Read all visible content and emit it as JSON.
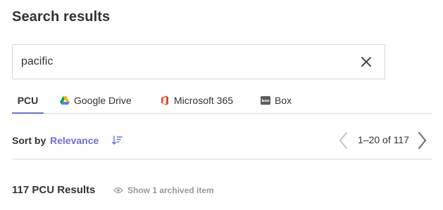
{
  "header": {
    "title": "Search results"
  },
  "search": {
    "value": "pacific",
    "clear_icon": "close-icon"
  },
  "tabs": [
    {
      "label": "PCU",
      "active": true
    },
    {
      "label": "Google Drive",
      "icon": "google-drive-icon"
    },
    {
      "label": "Microsoft 365",
      "icon": "microsoft-365-icon"
    },
    {
      "label": "Box",
      "icon": "box-icon"
    }
  ],
  "sort": {
    "label": "Sort by",
    "value": "Relevance",
    "icon": "sort-descending-icon"
  },
  "pagination": {
    "range": "1–20 of 117",
    "prev_icon": "chevron-left-icon",
    "next_icon": "chevron-right-icon"
  },
  "results": {
    "count_label": "117 PCU Results",
    "archived_label": "Show 1 archived item",
    "archived_icon": "eye-icon"
  },
  "colors": {
    "accent": "#6b6fd8",
    "text": "#333333",
    "muted": "#9a9a9a",
    "border": "#dcdcdc"
  }
}
